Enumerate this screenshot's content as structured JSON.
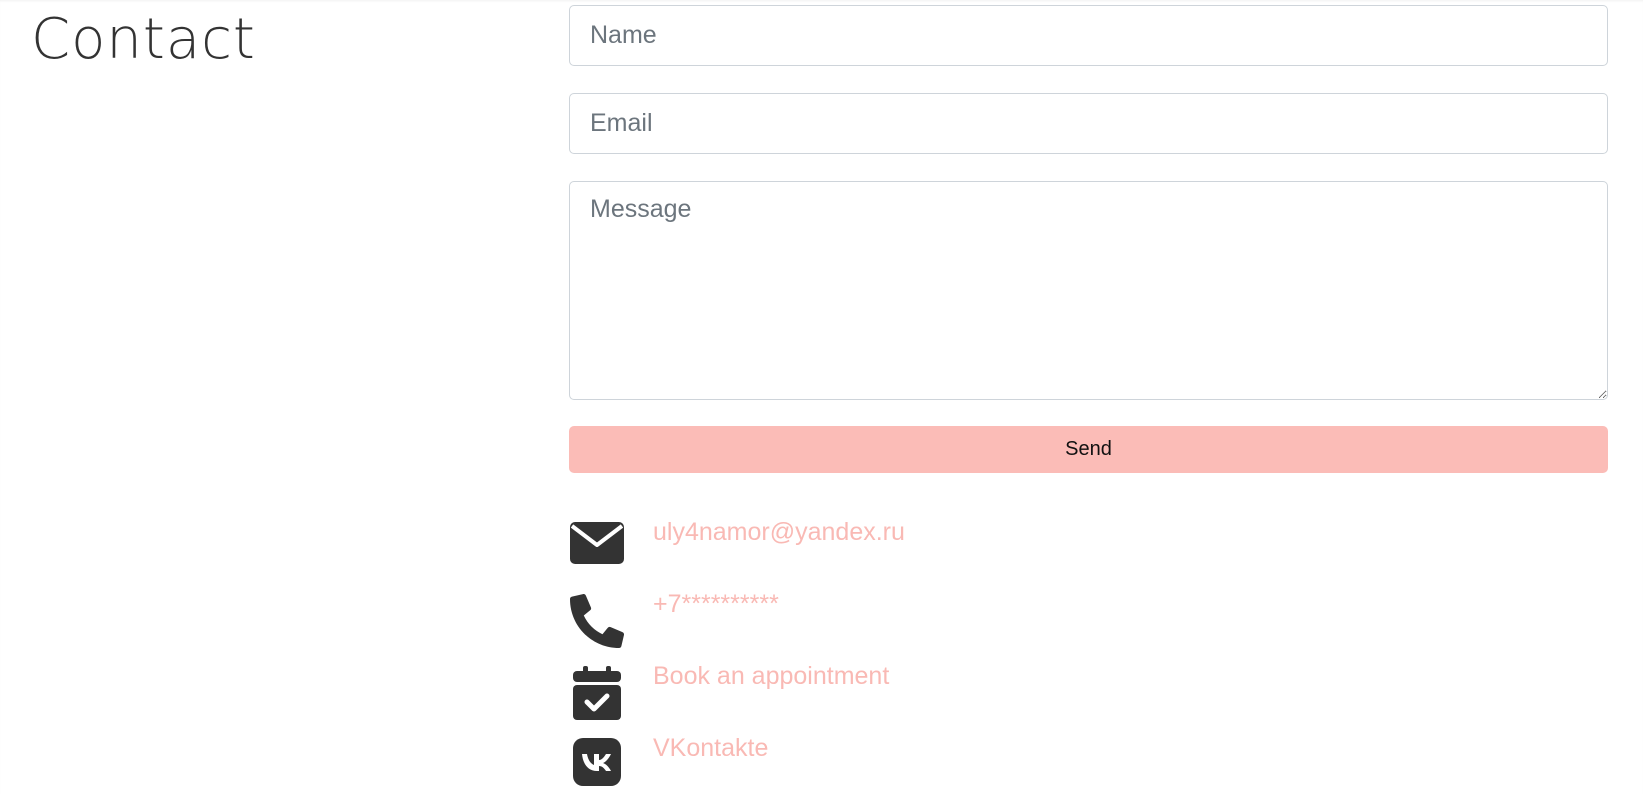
{
  "page": {
    "title": "Contact"
  },
  "form": {
    "name_placeholder": "Name",
    "email_placeholder": "Email",
    "message_placeholder": "Message",
    "send_label": "Send"
  },
  "contacts": [
    {
      "icon": "envelope-icon",
      "label": "uly4namor@yandex.ru"
    },
    {
      "icon": "phone-icon",
      "label": "+7**********"
    },
    {
      "icon": "calendar-check-icon",
      "label": "Book an appointment"
    },
    {
      "icon": "vk-icon",
      "label": "VKontakte"
    }
  ],
  "colors": {
    "accent": "#fbbcb7",
    "link": "#f9b9b4",
    "icon": "#333333",
    "text": "#333333"
  }
}
